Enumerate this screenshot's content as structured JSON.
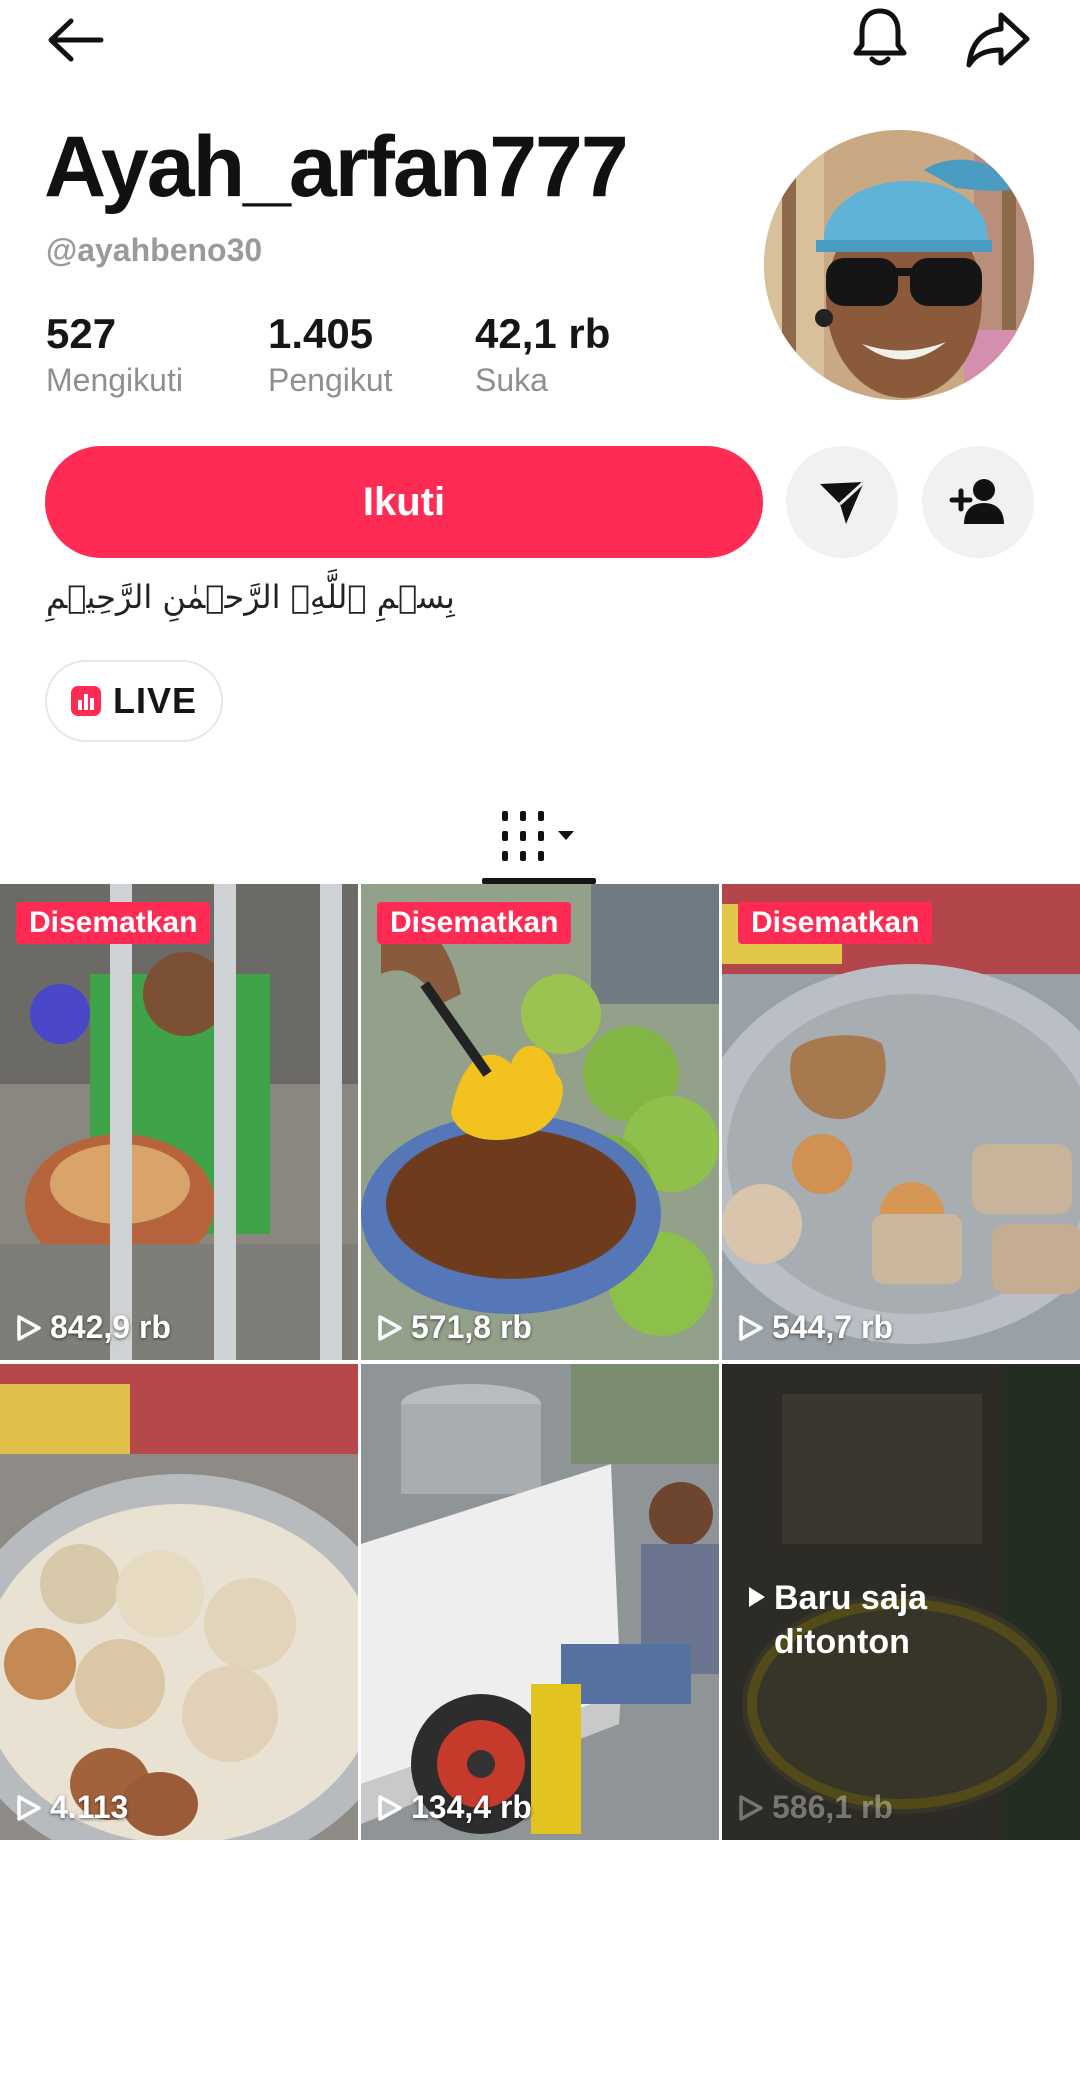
{
  "profile": {
    "display_name": "Ayah_arfan777",
    "handle": "@ayahbeno30",
    "bio": "بِسۡمِ ٱللَّهِۖ الرَّحۡمٰنِ الرَّحِیۡمِ"
  },
  "stats": {
    "following": {
      "value": "527",
      "label": "Mengikuti"
    },
    "followers": {
      "value": "1.405",
      "label": "Pengikut"
    },
    "likes": {
      "value": "42,1 rb",
      "label": "Suka"
    }
  },
  "actions": {
    "follow_label": "Ikuti"
  },
  "live_chip": {
    "label": "LIVE"
  },
  "colors": {
    "accent": "#fe2c55",
    "secondary_button": "#f1f1f1",
    "muted_text": "#8f8f8f"
  },
  "icons": {
    "top_left": "back-arrow-icon",
    "top_right": [
      "bell-icon",
      "share-icon"
    ],
    "action_buttons": [
      "send-message-icon",
      "add-friend-icon"
    ],
    "tab": "videos-grid-icon"
  },
  "videos": [
    {
      "pinned_label": "Disematkan",
      "views": "842,9 rb"
    },
    {
      "pinned_label": "Disematkan",
      "views": "571,8 rb"
    },
    {
      "pinned_label": "Disematkan",
      "views": "544,7 rb"
    },
    {
      "views": "4.113"
    },
    {
      "views": "134,4 rb"
    },
    {
      "overlay_label": "Baru saja ditonton",
      "views": "586,1 rb"
    }
  ]
}
